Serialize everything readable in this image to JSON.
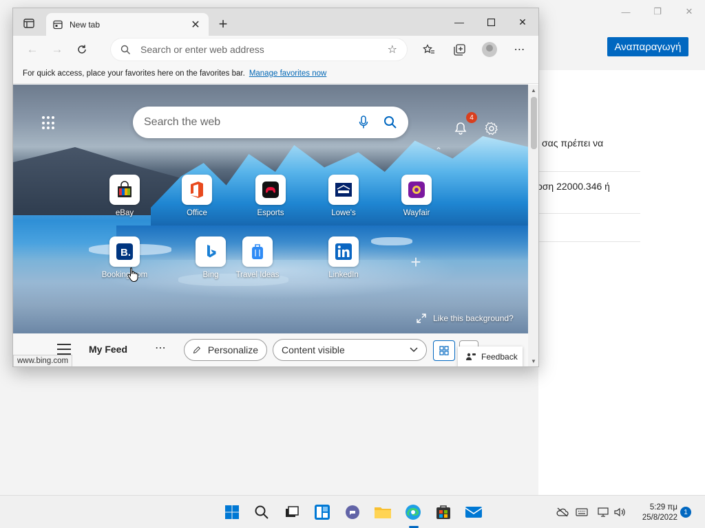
{
  "background_window": {
    "update_button": "Αναπαραγωγή",
    "text_line_1": "σας πρέπει να",
    "text_line_2": "οση 22000.346 ή"
  },
  "browser": {
    "tab": {
      "title": "New tab"
    },
    "address_bar": {
      "placeholder": "Search or enter web address"
    },
    "favorites_bar": {
      "message": "For quick access, place your favorites here on the favorites bar.",
      "link": "Manage favorites now"
    },
    "status_url": "www.bing.com"
  },
  "new_tab_page": {
    "search": {
      "placeholder": "Search the web"
    },
    "notifications_count": "4",
    "quick_links": [
      {
        "label": "eBay",
        "icon": "ebay-bag-icon"
      },
      {
        "label": "Office",
        "icon": "office-icon"
      },
      {
        "label": "Esports",
        "icon": "esports-controller-icon"
      },
      {
        "label": "Lowe's",
        "icon": "lowes-icon"
      },
      {
        "label": "Wayfair",
        "icon": "wayfair-icon"
      },
      {
        "label": "Booking.com",
        "icon": "booking-icon"
      },
      {
        "label": "Bing",
        "icon": "bing-icon"
      },
      {
        "label": "Travel Ideas",
        "icon": "suitcase-icon"
      },
      {
        "label": "LinkedIn",
        "icon": "linkedin-icon"
      }
    ],
    "like_background": "Like this background?",
    "feed": {
      "title": "My Feed",
      "personalize": "Personalize",
      "content_visibility": "Content visible",
      "feedback": "Feedback"
    }
  },
  "taskbar": {
    "time": "5:29 πμ",
    "date": "25/8/2022",
    "notification_count": "1"
  },
  "colors": {
    "accent": "#0067c0",
    "notification_badge": "#d93f1e"
  }
}
